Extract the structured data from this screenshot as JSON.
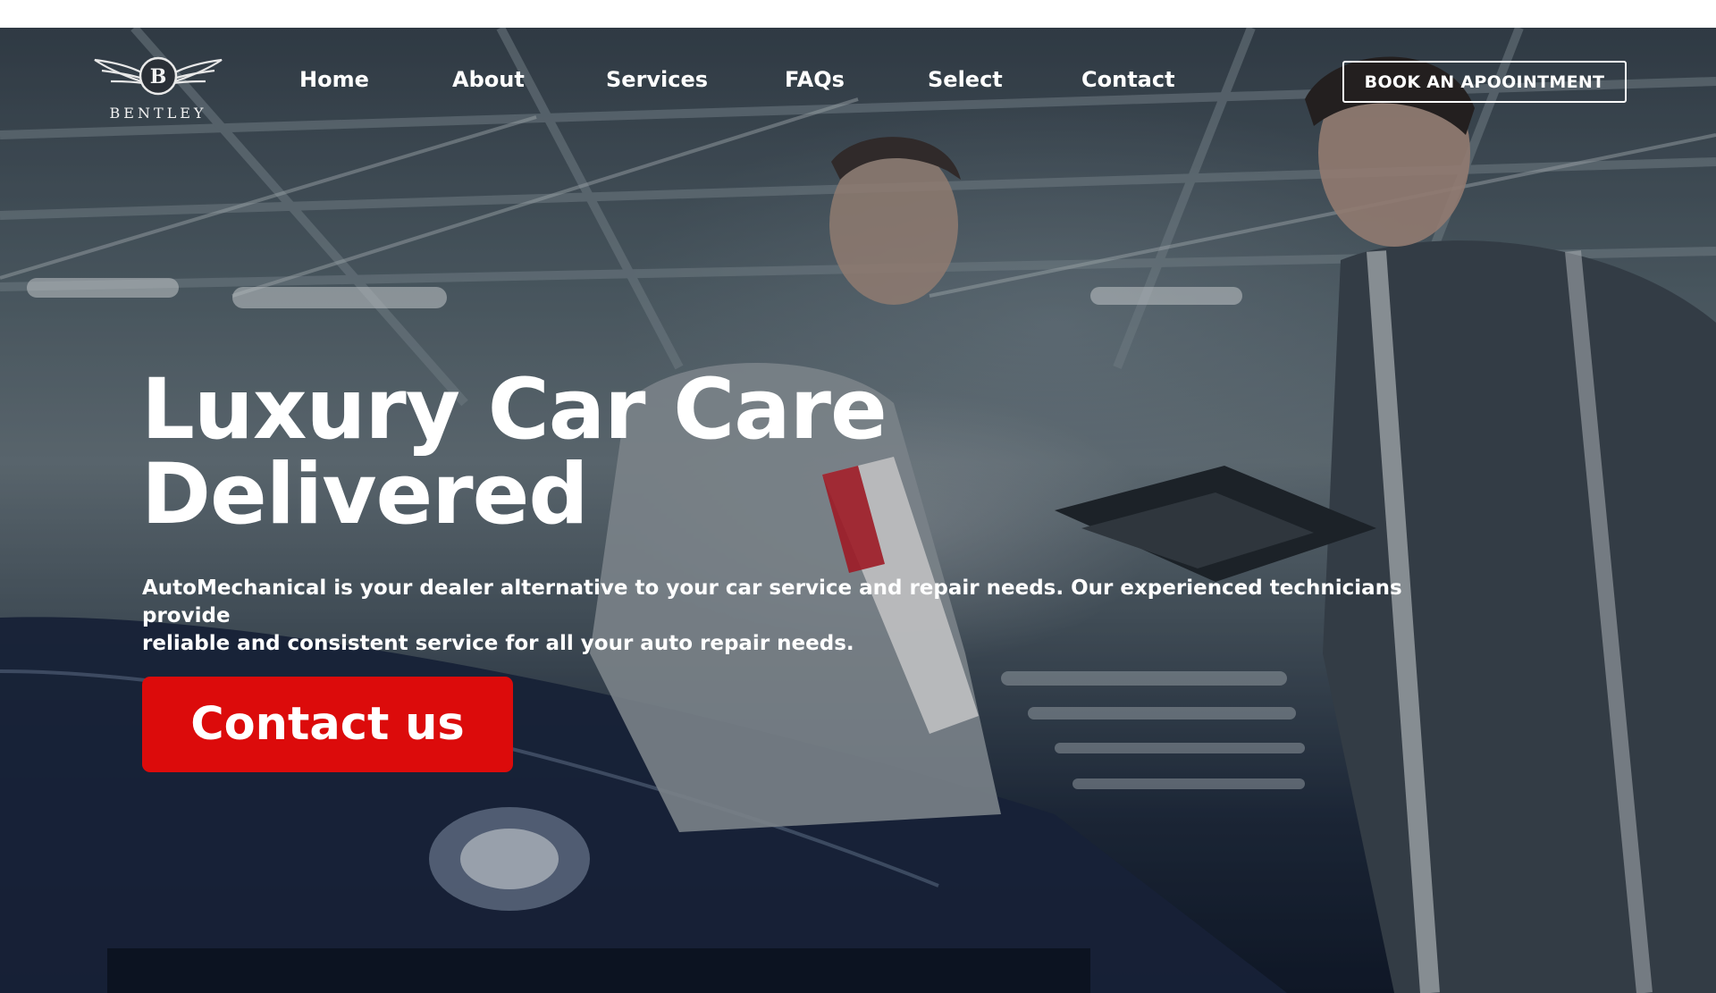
{
  "brand": {
    "logo_text": "BENTLEY",
    "logo_letter": "B",
    "logo_icon": "winged-b-icon"
  },
  "nav": {
    "items": [
      {
        "label": "Home"
      },
      {
        "label": "About"
      },
      {
        "label": "Services"
      },
      {
        "label": "FAQs"
      },
      {
        "label": "Select"
      },
      {
        "label": "Contact"
      }
    ],
    "cta_label": "BOOK AN APOOINTMENT"
  },
  "hero": {
    "headline_line1": "Luxury Car Care",
    "headline_line2": "Delivered",
    "subtext_line1": "AutoMechanical is your dealer alternative to your car service and repair needs. Our experienced technicians  provide",
    "subtext_line2": "reliable and consistent service for all your auto repair  needs.",
    "cta_label": "Contact us",
    "background_image": "mechanics-inspecting-car-photo"
  },
  "colors": {
    "accent": "#dc0b0b",
    "text": "#ffffff",
    "overlay": "#1a2330"
  }
}
